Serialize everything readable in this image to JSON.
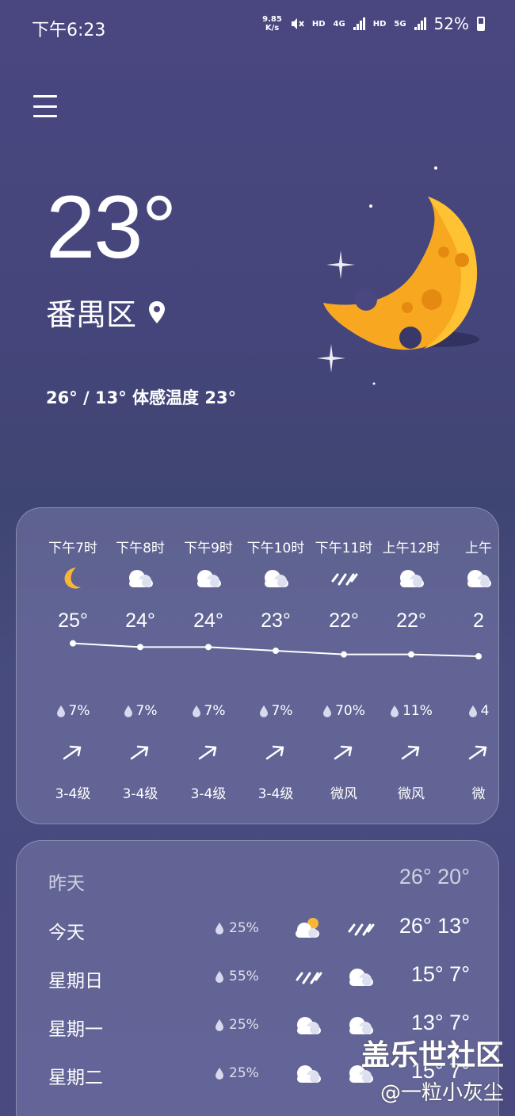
{
  "status": {
    "time": "下午6:23",
    "net_speed_value": "9.85",
    "net_speed_unit": "K/s",
    "hd1": "HD",
    "net1": "4G",
    "hd2": "HD",
    "net2": "5G",
    "battery": "52%"
  },
  "current": {
    "temp": "23°",
    "location": "番禺区",
    "range": "26° / 13° 体感温度 23°"
  },
  "hourly": [
    {
      "time": "下午7时",
      "icon": "moon-icon",
      "temp": "25°",
      "rain": "7%",
      "wind": "3-4级"
    },
    {
      "time": "下午8时",
      "icon": "cloud-icon",
      "temp": "24°",
      "rain": "7%",
      "wind": "3-4级"
    },
    {
      "time": "下午9时",
      "icon": "cloud-icon",
      "temp": "24°",
      "rain": "7%",
      "wind": "3-4级"
    },
    {
      "time": "下午10时",
      "icon": "cloud-icon",
      "temp": "23°",
      "rain": "7%",
      "wind": "3-4级"
    },
    {
      "time": "下午11时",
      "icon": "rain-icon",
      "temp": "22°",
      "rain": "70%",
      "wind": "微风"
    },
    {
      "time": "上午12时",
      "icon": "cloud-icon",
      "temp": "22°",
      "rain": "11%",
      "wind": "微风"
    },
    {
      "time": "上午",
      "icon": "cloud-icon",
      "temp": "2",
      "rain": "4",
      "wind": "微"
    }
  ],
  "hourly_temp_values": [
    25,
    24,
    24,
    23,
    22,
    22,
    21.5
  ],
  "daily": [
    {
      "day": "昨天",
      "rain": "",
      "icon1": "",
      "icon2": "",
      "temps": "26° 20°",
      "dim": true
    },
    {
      "day": "今天",
      "rain": "25%",
      "icon1": "partly-cloudy-icon",
      "icon2": "rain-icon",
      "temps": "26° 13°",
      "dim": false
    },
    {
      "day": "星期日",
      "rain": "55%",
      "icon1": "rain-icon",
      "icon2": "cloud-icon",
      "temps": "15°  7°",
      "dim": false
    },
    {
      "day": "星期一",
      "rain": "25%",
      "icon1": "cloud-icon",
      "icon2": "cloud-icon",
      "temps": "13°  7°",
      "dim": false
    },
    {
      "day": "星期二",
      "rain": "25%",
      "icon1": "cloud-icon",
      "icon2": "cloud-icon",
      "temps": "15°  7°",
      "dim": false
    }
  ],
  "watermark": {
    "title": "盖乐世社区",
    "sub": "@一粒小灰尘"
  },
  "colors": {
    "moon": "#f7a820",
    "moon_shadow": "#e58a10"
  }
}
